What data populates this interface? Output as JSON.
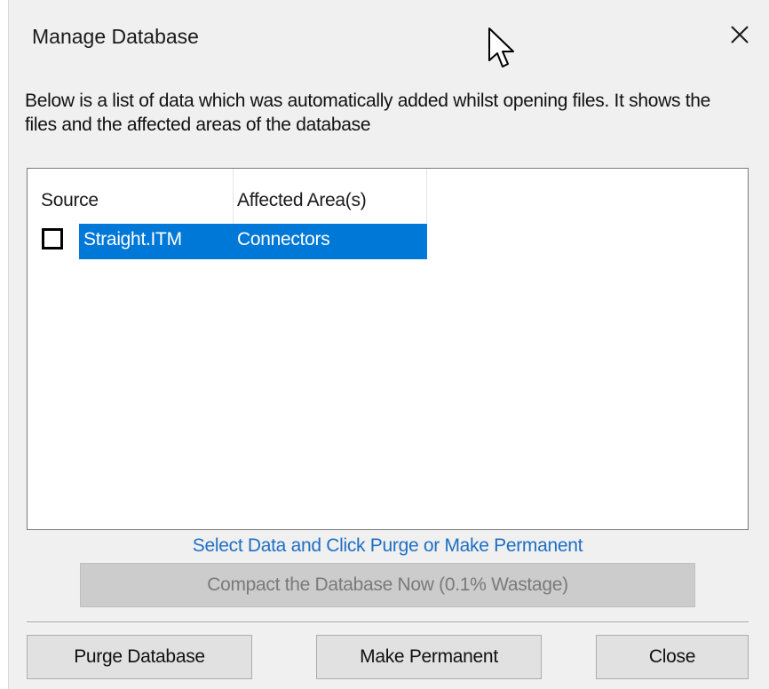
{
  "window": {
    "title": "Manage Database"
  },
  "description": "Below is a list of data which was automatically added whilst opening files. It shows the files and the affected areas of the database",
  "list": {
    "columns": [
      "Source",
      "Affected Area(s)"
    ],
    "rows": [
      {
        "checked": false,
        "selected": true,
        "source": "Straight.ITM",
        "area": "Connectors"
      }
    ]
  },
  "hint": "Select Data and Click Purge or Make Permanent",
  "buttons": {
    "compact": "Compact the Database Now (0.1% Wastage)",
    "purge": "Purge Database",
    "make_permanent": "Make Permanent",
    "close": "Close"
  },
  "colors": {
    "selection": "#0078d7",
    "hint": "#1f6fc4",
    "dialog_bg": "#f0f0f0"
  },
  "icons": {
    "close": "close-icon",
    "cursor": "mouse-pointer-icon"
  }
}
